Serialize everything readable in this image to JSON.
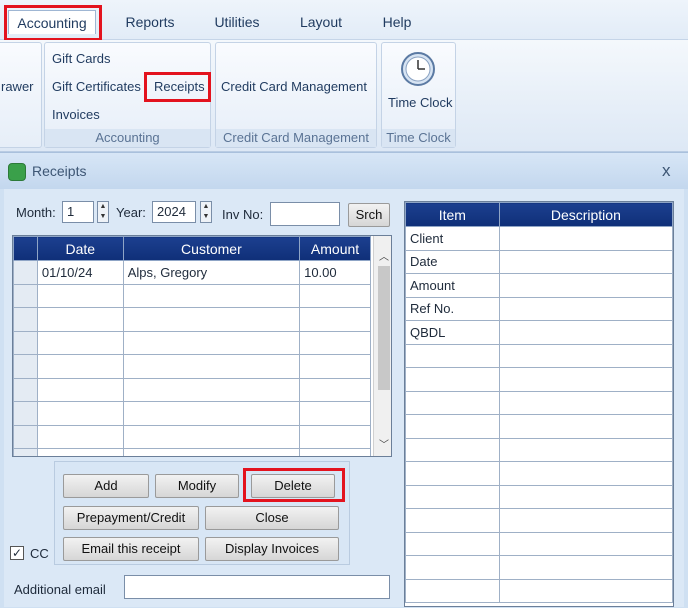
{
  "menu": {
    "accounting": "Accounting",
    "reports": "Reports",
    "utilities": "Utilities",
    "layout": "Layout",
    "help": "Help"
  },
  "ribbon": {
    "drawer_partial": "rawer",
    "gift_cards": "Gift Cards",
    "gift_certificates": "Gift Certificates",
    "receipts": "Receipts",
    "invoices": "Invoices",
    "accounting_group": "Accounting",
    "credit_card_management": "Credit Card Management",
    "credit_card_group": "Credit Card Management",
    "time_clock": "Time Clock",
    "time_clock_group": "Time Clock"
  },
  "window": {
    "title": "Receipts",
    "close": "x"
  },
  "search": {
    "month_label": "Month:",
    "month_value": "1",
    "year_label": "Year:",
    "year_value": "2024",
    "inv_label": "Inv No:",
    "inv_value": "",
    "search_button": "Srch"
  },
  "receipts_table": {
    "headers": [
      "Date",
      "Customer",
      "Amount"
    ],
    "rows": [
      {
        "date": "01/10/24",
        "customer": "Alps, Gregory",
        "amount": "10.00"
      }
    ]
  },
  "buttons": {
    "add": "Add",
    "modify": "Modify",
    "delete": "Delete",
    "prepayment": "Prepayment/Credit",
    "close": "Close",
    "email": "Email this receipt",
    "display_invoices": "Display Invoices"
  },
  "cc_label": "CC",
  "cc_checked": true,
  "additional_email_label": "Additional email",
  "additional_email_value": "",
  "detail_table": {
    "headers": [
      "Item",
      "Description"
    ],
    "items": [
      "Client",
      "Date",
      "Amount",
      "Ref No.",
      "QBDL"
    ]
  }
}
